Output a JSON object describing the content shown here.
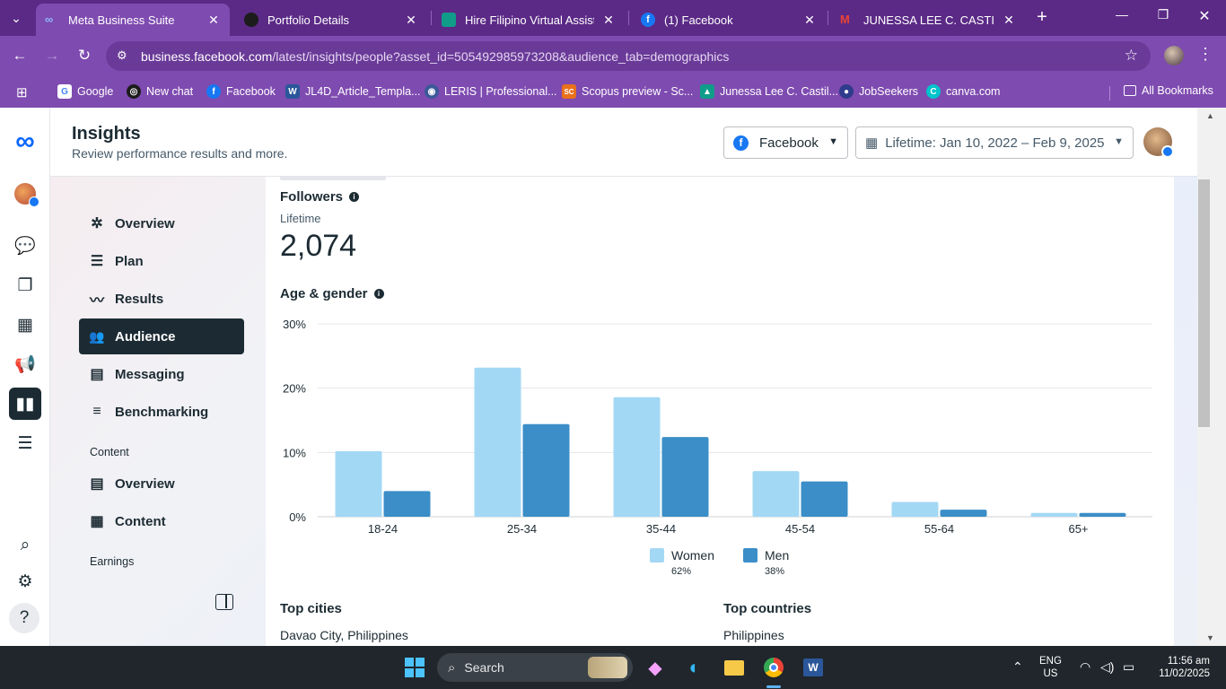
{
  "browser": {
    "tabs": [
      {
        "title": "Meta Business Suite",
        "favicon_color": "#1877f2",
        "favicon": "meta-logo-icon"
      },
      {
        "title": "Portfolio Details",
        "favicon_color": "#1c1c1c",
        "favicon": "portfolio-icon"
      },
      {
        "title": "Hire Filipino Virtual Assistants",
        "favicon_color": "#0f9d8a",
        "favicon": "hire-icon"
      },
      {
        "title": "(1) Facebook",
        "favicon_color": "#1877f2",
        "favicon": "facebook-icon"
      },
      {
        "title": "JUNESSA LEE C. CASTILLO - Gmail",
        "favicon_color": "#c5221f",
        "favicon": "gmail-icon"
      }
    ],
    "url_host": "business.facebook.com",
    "url_path": "/latest/insights/people?asset_id=505492985973208&audience_tab=demographics",
    "bookmarks": [
      {
        "label": "Google",
        "color": "#ffffff",
        "glyph": "G"
      },
      {
        "label": "New chat",
        "color": "#1c1c1c",
        "glyph": "◎"
      },
      {
        "label": "Facebook",
        "color": "#1877f2",
        "glyph": "f"
      },
      {
        "label": "JL4D_Article_Templa...",
        "color": "#2b579a",
        "glyph": "W"
      },
      {
        "label": "LERIS | Professional...",
        "color": "#3b5998",
        "glyph": "◉"
      },
      {
        "label": "Scopus preview - Sc...",
        "color": "#e9711c",
        "glyph": "SC"
      },
      {
        "label": "Junessa Lee C. Castil...",
        "color": "#0f9d8a",
        "glyph": "▲"
      },
      {
        "label": "JobSeekers",
        "color": "#2f3b8c",
        "glyph": "●"
      },
      {
        "label": "canva.com",
        "color": "#00c4cc",
        "glyph": "C"
      }
    ],
    "all_bookmarks": "All Bookmarks"
  },
  "header": {
    "title": "Insights",
    "subtitle": "Review performance results and more.",
    "platform": "Facebook",
    "date_range": "Lifetime: Jan 10, 2022 – Feb 9, 2025"
  },
  "sidebar": {
    "items": [
      {
        "label": "Overview",
        "icon": "overview-icon",
        "glyph": "✲"
      },
      {
        "label": "Plan",
        "icon": "plan-icon",
        "glyph": "☰"
      },
      {
        "label": "Results",
        "icon": "results-icon",
        "glyph": "〰"
      },
      {
        "label": "Audience",
        "icon": "audience-icon",
        "glyph": "👥",
        "active": true
      },
      {
        "label": "Messaging",
        "icon": "messaging-icon",
        "glyph": "▤"
      },
      {
        "label": "Benchmarking",
        "icon": "benchmarking-icon",
        "glyph": "≡"
      }
    ],
    "content_section": "Content",
    "content_items": [
      {
        "label": "Overview",
        "icon": "content-overview-icon",
        "glyph": "▤"
      },
      {
        "label": "Content",
        "icon": "content-table-icon",
        "glyph": "▦"
      }
    ],
    "earnings_section": "Earnings"
  },
  "followers": {
    "title": "Followers",
    "period": "Lifetime",
    "count": "2,074"
  },
  "age_gender": {
    "title": "Age & gender",
    "legend": [
      {
        "label": "Women",
        "pct": "62%",
        "color": "#a3d8f5"
      },
      {
        "label": "Men",
        "pct": "38%",
        "color": "#3b8ec8"
      }
    ]
  },
  "chart_data": {
    "type": "bar",
    "title": "Age & gender",
    "categories": [
      "18-24",
      "25-34",
      "35-44",
      "45-54",
      "55-64",
      "65+"
    ],
    "series": [
      {
        "name": "Women",
        "values": [
          10.2,
          23.2,
          18.6,
          7.1,
          2.3,
          0.6
        ],
        "color": "#a3d8f5"
      },
      {
        "name": "Men",
        "values": [
          4.0,
          14.4,
          12.4,
          5.5,
          1.1,
          0.6
        ],
        "color": "#3b8ec8"
      }
    ],
    "ylim": [
      0,
      30
    ],
    "yticks": [
      "0%",
      "10%",
      "20%",
      "30%"
    ],
    "grid": true,
    "legend_position": "bottom"
  },
  "top_cities": {
    "title": "Top cities",
    "first": "Davao City, Philippines"
  },
  "top_countries": {
    "title": "Top countries",
    "first": "Philippines"
  },
  "taskbar": {
    "search": "Search",
    "lang_top": "ENG",
    "lang_bottom": "US",
    "time": "11:56 am",
    "date": "11/02/2025"
  }
}
